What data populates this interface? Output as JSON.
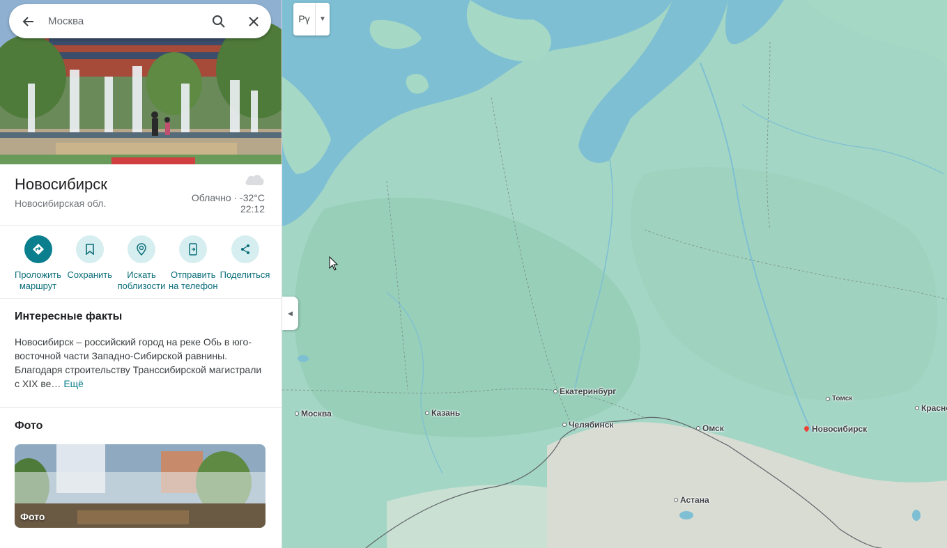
{
  "search": {
    "query": "Москва"
  },
  "place": {
    "name": "Новосибирск",
    "region": "Новосибирская обл.",
    "weather": "Облачно · -32°C",
    "time": "22:12"
  },
  "actions": [
    {
      "label_line1": "Проложить",
      "label_line2": "маршрут",
      "icon": "directions-icon",
      "primary": true
    },
    {
      "label_line1": "Сохранить",
      "label_line2": "",
      "icon": "bookmark-icon",
      "primary": false
    },
    {
      "label_line1": "Искать",
      "label_line2": "поблизости",
      "icon": "nearby-search-icon",
      "primary": false
    },
    {
      "label_line1": "Отправить",
      "label_line2": "на телефон",
      "icon": "send-to-phone-icon",
      "primary": false
    },
    {
      "label_line1": "Поделиться",
      "label_line2": "",
      "icon": "share-icon",
      "primary": false
    }
  ],
  "facts": {
    "title": "Интересные факты",
    "text": "Новосибирск – российский город на реке Обь в юго-восточной части Западно-Сибирской равнины. Благодаря строительству Транссибирской магистрали с XIX ве…",
    "more": "Ещё"
  },
  "photos": {
    "title": "Фото",
    "card_label": "Фото"
  },
  "map": {
    "language_button": "Рү",
    "cities": [
      {
        "id": "moskva",
        "name": "Москва",
        "marker": "dot",
        "small": false
      },
      {
        "id": "kazan",
        "name": "Казань",
        "marker": "dot",
        "small": false
      },
      {
        "id": "ekaterinburg",
        "name": "Екатеринбург",
        "marker": "dot",
        "small": false
      },
      {
        "id": "chelyabinsk",
        "name": "Челябинск",
        "marker": "dot",
        "small": false
      },
      {
        "id": "omsk",
        "name": "Омск",
        "marker": "dot",
        "small": false
      },
      {
        "id": "tomsk",
        "name": "Томск",
        "marker": "dot",
        "small": true
      },
      {
        "id": "novosibirsk",
        "name": "Новосибирск",
        "marker": "pin",
        "small": false
      },
      {
        "id": "krasnoyarsk",
        "name": "Красно",
        "marker": "dot",
        "small": false
      },
      {
        "id": "astana",
        "name": "Астана",
        "marker": "dot",
        "small": false
      }
    ],
    "colors": {
      "water": "#7ebfd3",
      "land": "#a6d8c6",
      "forest": "#93cdb6",
      "steppe": "#d9dcd3"
    }
  }
}
